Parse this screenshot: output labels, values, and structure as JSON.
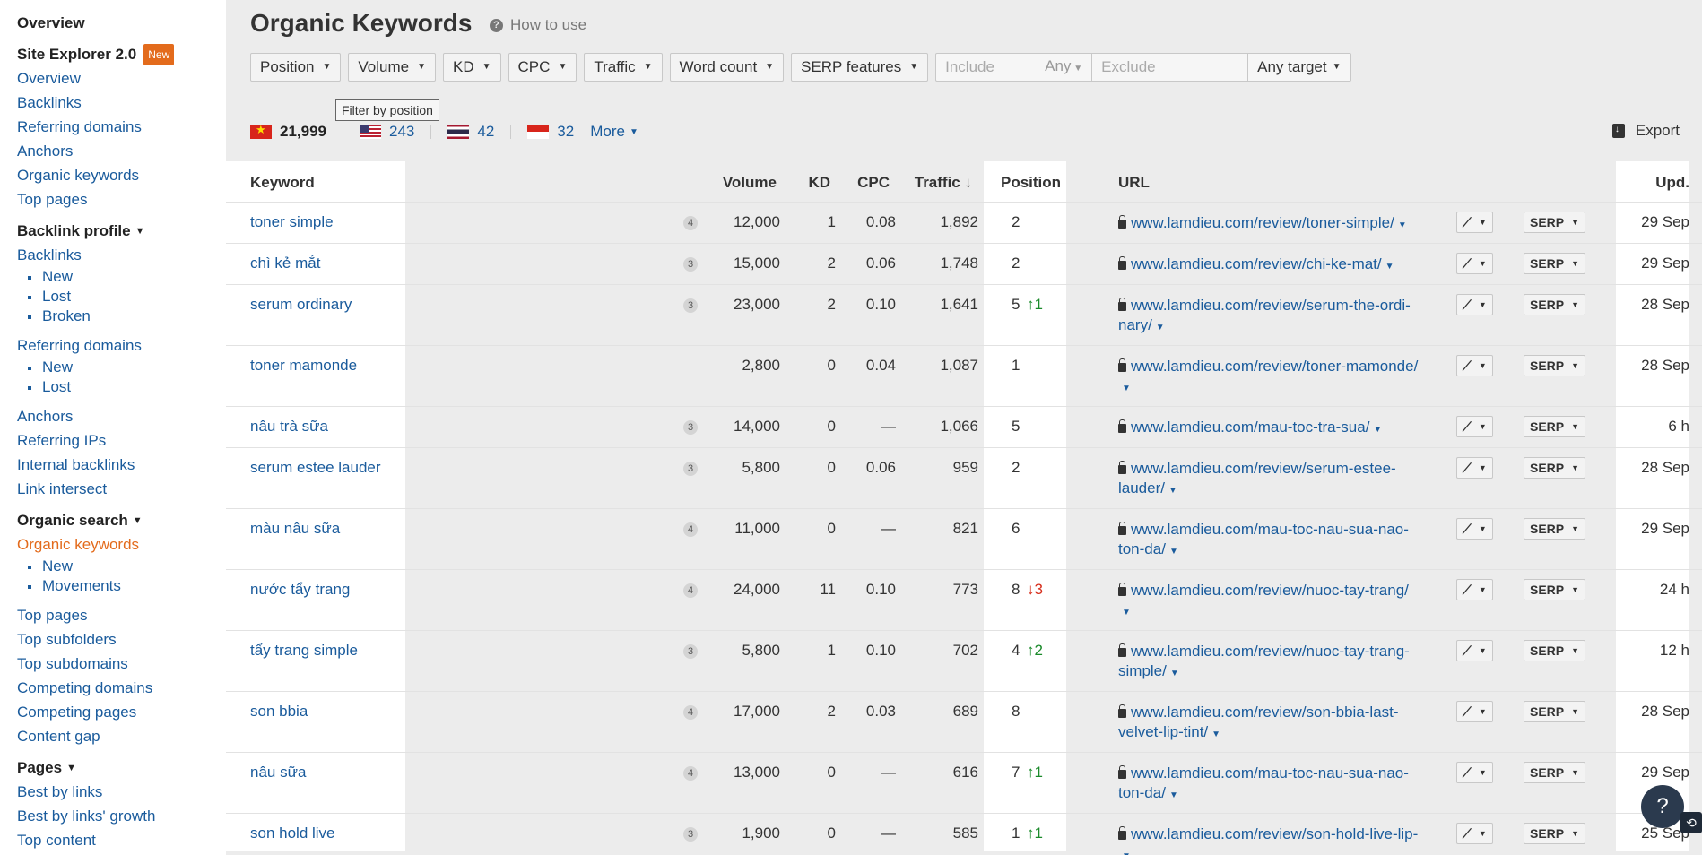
{
  "sidebar": {
    "overview_top": "Overview",
    "site_explorer": "Site Explorer 2.0",
    "new_badge": "New",
    "site_items": [
      "Overview",
      "Backlinks",
      "Referring domains",
      "Anchors",
      "Organic keywords",
      "Top pages"
    ],
    "backlink_profile": "Backlink profile",
    "backlinks": "Backlinks",
    "backlinks_sub": [
      "New",
      "Lost",
      "Broken"
    ],
    "referring_domains": "Referring domains",
    "refdomains_sub": [
      "New",
      "Lost"
    ],
    "backlink_items": [
      "Anchors",
      "Referring IPs",
      "Internal backlinks",
      "Link intersect"
    ],
    "organic_search": "Organic search",
    "organic_keywords": "Organic keywords",
    "organic_sub": [
      "New",
      "Movements"
    ],
    "organic_items": [
      "Top pages",
      "Top subfolders",
      "Top subdomains",
      "Competing domains",
      "Competing pages",
      "Content gap"
    ],
    "pages": "Pages",
    "pages_items": [
      "Best by links",
      "Best by links' growth",
      "Top content"
    ]
  },
  "header": {
    "title": "Organic Keywords",
    "how_to_use": "How to use"
  },
  "filters": {
    "buttons": [
      "Position",
      "Volume",
      "KD",
      "CPC",
      "Traffic",
      "Word count",
      "SERP features"
    ],
    "include_placeholder": "Include",
    "any": "Any",
    "exclude_placeholder": "Exclude",
    "any_target": "Any target",
    "tooltip": "Filter by position"
  },
  "countries": {
    "items": [
      {
        "flag": "vn",
        "count": "21,999"
      },
      {
        "flag": "us",
        "count": "243"
      },
      {
        "flag": "th",
        "count": "42"
      },
      {
        "flag": "id",
        "count": "32"
      }
    ],
    "more": "More",
    "export": "Export"
  },
  "table": {
    "headers": {
      "keyword": "Keyword",
      "volume": "Volume",
      "kd": "KD",
      "cpc": "CPC",
      "traffic": "Traffic ↓",
      "position": "Position",
      "url": "URL",
      "upd": "Upd."
    },
    "serp_label": "SERP",
    "rows": [
      {
        "keyword": "toner simple",
        "sf": "4",
        "volume": "12,000",
        "kd": "1",
        "cpc": "0.08",
        "traffic": "1,892",
        "position": "2",
        "change": "",
        "url1": "www.lamdieu.com/review/toner-simple/",
        "url2": "",
        "upd": "29 Sep"
      },
      {
        "keyword": "chì kẻ mắt",
        "sf": "3",
        "volume": "15,000",
        "kd": "2",
        "cpc": "0.06",
        "traffic": "1,748",
        "position": "2",
        "change": "",
        "url1": "www.lamdieu.com/review/chi-ke-mat/",
        "url2": "",
        "upd": "29 Sep"
      },
      {
        "keyword": "serum ordinary",
        "sf": "3",
        "volume": "23,000",
        "kd": "2",
        "cpc": "0.10",
        "traffic": "1,641",
        "position": "5",
        "change": "↑1",
        "url1": "www.lamdieu.com/review/serum-the-ordi-",
        "url2": "nary/",
        "upd": "28 Sep"
      },
      {
        "keyword": "toner mamonde",
        "sf": "",
        "volume": "2,800",
        "kd": "0",
        "cpc": "0.04",
        "traffic": "1,087",
        "position": "1",
        "change": "",
        "url1": "www.lamdieu.com/review/toner-mamonde/",
        "url2": "",
        "upd": "28 Sep"
      },
      {
        "keyword": "nâu trà sữa",
        "sf": "3",
        "volume": "14,000",
        "kd": "0",
        "cpc": "—",
        "traffic": "1,066",
        "position": "5",
        "change": "",
        "url1": "www.lamdieu.com/mau-toc-tra-sua/",
        "url2": "",
        "upd": "6 h"
      },
      {
        "keyword": "serum estee lauder",
        "sf": "3",
        "volume": "5,800",
        "kd": "0",
        "cpc": "0.06",
        "traffic": "959",
        "position": "2",
        "change": "",
        "url1": "www.lamdieu.com/review/serum-estee-",
        "url2": "lauder/",
        "upd": "28 Sep"
      },
      {
        "keyword": "màu nâu sữa",
        "sf": "4",
        "volume": "11,000",
        "kd": "0",
        "cpc": "—",
        "traffic": "821",
        "position": "6",
        "change": "",
        "url1": "www.lamdieu.com/mau-toc-nau-sua-nao-",
        "url2": "ton-da/",
        "upd": "29 Sep"
      },
      {
        "keyword": "nước tẩy trang",
        "sf": "4",
        "volume": "24,000",
        "kd": "11",
        "cpc": "0.10",
        "traffic": "773",
        "position": "8",
        "change": "↓3",
        "url1": "www.lamdieu.com/review/nuoc-tay-trang/",
        "url2": "",
        "upd": "24 h"
      },
      {
        "keyword": "tẩy trang simple",
        "sf": "3",
        "volume": "5,800",
        "kd": "1",
        "cpc": "0.10",
        "traffic": "702",
        "position": "4",
        "change": "↑2",
        "url1": "www.lamdieu.com/review/nuoc-tay-trang-",
        "url2": "simple/",
        "upd": "12 h"
      },
      {
        "keyword": "son bbia",
        "sf": "4",
        "volume": "17,000",
        "kd": "2",
        "cpc": "0.03",
        "traffic": "689",
        "position": "8",
        "change": "",
        "url1": "www.lamdieu.com/review/son-bbia-last-",
        "url2": "velvet-lip-tint/",
        "upd": "28 Sep"
      },
      {
        "keyword": "nâu sữa",
        "sf": "4",
        "volume": "13,000",
        "kd": "0",
        "cpc": "—",
        "traffic": "616",
        "position": "7",
        "change": "↑1",
        "url1": "www.lamdieu.com/mau-toc-nau-sua-nao-",
        "url2": "ton-da/",
        "upd": "29 Sep"
      },
      {
        "keyword": "son hold live",
        "sf": "3",
        "volume": "1,900",
        "kd": "0",
        "cpc": "—",
        "traffic": "585",
        "position": "1",
        "change": "↑1",
        "url1": "www.lamdieu.com/review/son-hold-live-lip-",
        "url2": "",
        "upd": "25 Sep"
      }
    ]
  },
  "help_label": "?"
}
